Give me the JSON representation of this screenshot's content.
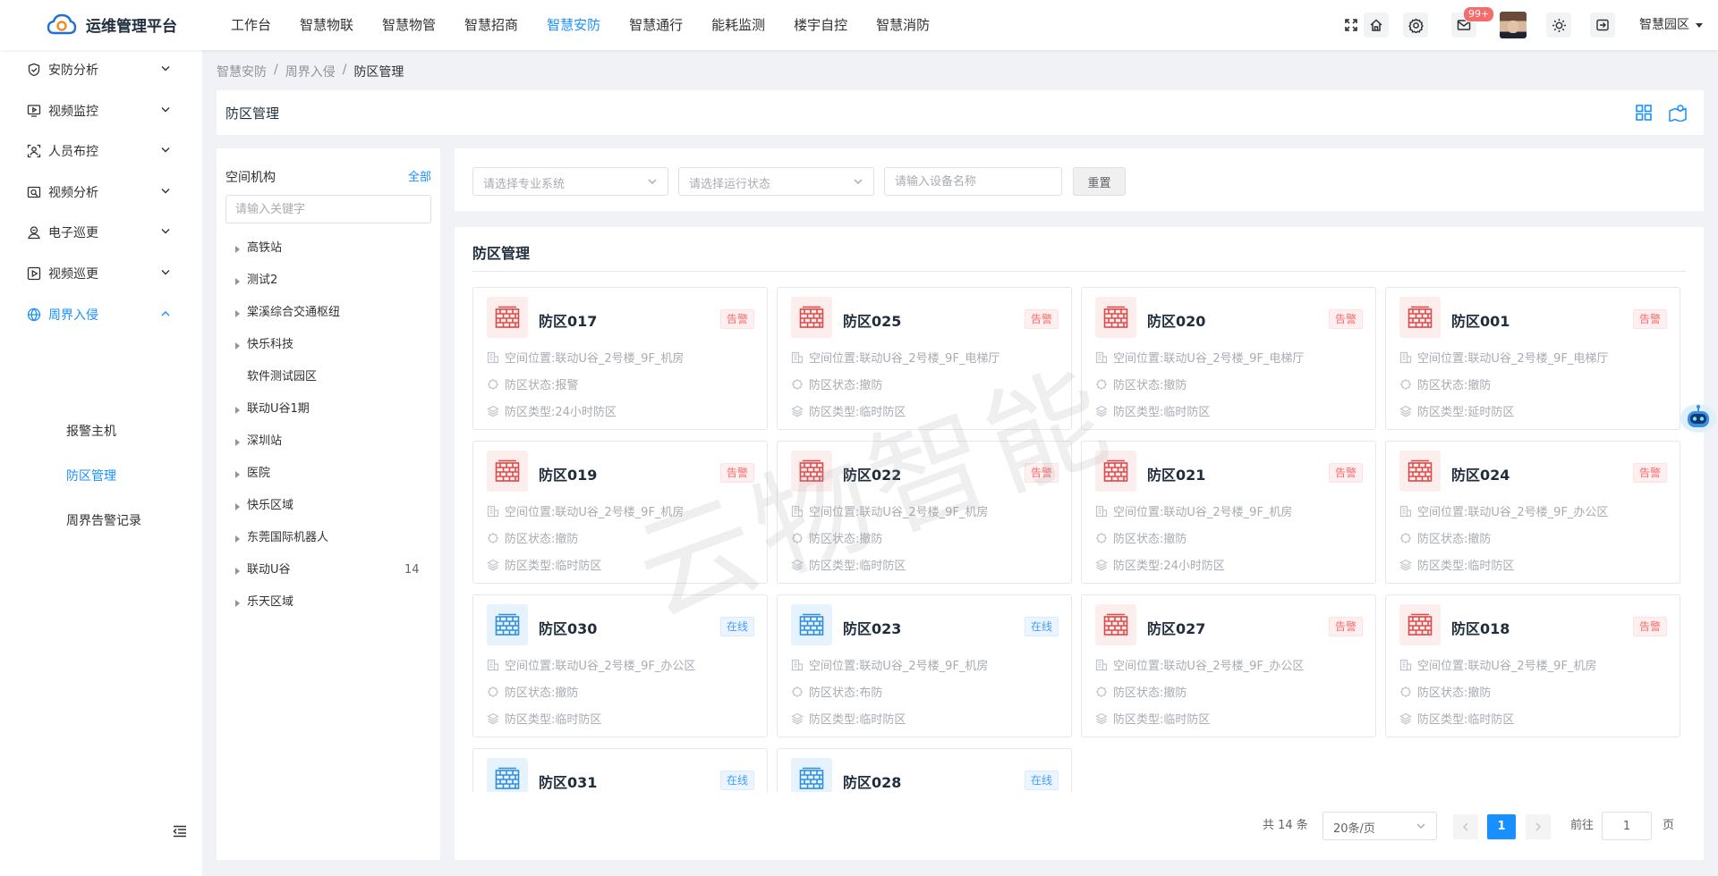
{
  "app": {
    "title": "运维管理平台"
  },
  "topnav": [
    {
      "label": "工作台",
      "active": false
    },
    {
      "label": "智慧物联",
      "active": false
    },
    {
      "label": "智慧物管",
      "active": false
    },
    {
      "label": "智慧招商",
      "active": false
    },
    {
      "label": "智慧安防",
      "active": true
    },
    {
      "label": "智慧通行",
      "active": false
    },
    {
      "label": "能耗监测",
      "active": false
    },
    {
      "label": "楼宇自控",
      "active": false
    },
    {
      "label": "智慧消防",
      "active": false
    }
  ],
  "header": {
    "mail_badge": "99+",
    "park_label": "智慧园区"
  },
  "sidebar": {
    "items": [
      {
        "label": "安防分析",
        "icon": "shield-check-icon"
      },
      {
        "label": "视频监控",
        "icon": "monitor-play-icon"
      },
      {
        "label": "人员布控",
        "icon": "person-scan-icon"
      },
      {
        "label": "视频分析",
        "icon": "video-search-icon"
      },
      {
        "label": "电子巡更",
        "icon": "patrol-icon"
      },
      {
        "label": "视频巡更",
        "icon": "video-play-icon"
      },
      {
        "label": "周界入侵",
        "icon": "globe-icon",
        "open": true
      }
    ],
    "subitems": [
      {
        "label": "报警主机",
        "active": false
      },
      {
        "label": "防区管理",
        "active": true
      },
      {
        "label": "周界告警记录",
        "active": false
      }
    ]
  },
  "breadcrumb": [
    "智慧安防",
    "周界入侵",
    "防区管理"
  ],
  "page": {
    "title": "防区管理"
  },
  "tree": {
    "title": "空间机构",
    "all_label": "全部",
    "search_placeholder": "请输入关键字",
    "nodes": [
      {
        "label": "高铁站",
        "expandable": true,
        "count": ""
      },
      {
        "label": "测试2",
        "expandable": true,
        "count": ""
      },
      {
        "label": "棠溪综合交通枢纽",
        "expandable": true,
        "count": ""
      },
      {
        "label": "快乐科技",
        "expandable": true,
        "count": ""
      },
      {
        "label": "软件测试园区",
        "expandable": false,
        "count": ""
      },
      {
        "label": "联动U谷1期",
        "expandable": true,
        "count": ""
      },
      {
        "label": "深圳站",
        "expandable": true,
        "count": ""
      },
      {
        "label": "医院",
        "expandable": true,
        "count": ""
      },
      {
        "label": "快乐区域",
        "expandable": true,
        "count": ""
      },
      {
        "label": "东莞国际机器人",
        "expandable": true,
        "count": ""
      },
      {
        "label": "联动U谷",
        "expandable": true,
        "count": "14"
      },
      {
        "label": "乐天区域",
        "expandable": true,
        "count": ""
      }
    ]
  },
  "filters": {
    "system_placeholder": "请选择专业系统",
    "status_placeholder": "请选择运行状态",
    "device_placeholder": "请输入设备名称",
    "reset_label": "重置"
  },
  "content": {
    "title": "防区管理"
  },
  "labels": {
    "location": "空间位置: ",
    "state": "防区状态: ",
    "type": "防区类型: "
  },
  "colors": {
    "accent": "#1890ff",
    "alarm": "#e04848",
    "online": "#2f8ee0"
  },
  "zones": [
    {
      "name": "防区017",
      "tag": "告警",
      "kind": "alarm",
      "location": "联动U谷_2号楼_9F_机房",
      "state": "报警",
      "type": "24小时防区"
    },
    {
      "name": "防区025",
      "tag": "告警",
      "kind": "alarm",
      "location": "联动U谷_2号楼_9F_电梯厅",
      "state": "撤防",
      "type": "临时防区"
    },
    {
      "name": "防区020",
      "tag": "告警",
      "kind": "alarm",
      "location": "联动U谷_2号楼_9F_电梯厅",
      "state": "撤防",
      "type": "临时防区"
    },
    {
      "name": "防区001",
      "tag": "告警",
      "kind": "alarm",
      "location": "联动U谷_2号楼_9F_电梯厅",
      "state": "撤防",
      "type": "延时防区"
    },
    {
      "name": "防区019",
      "tag": "告警",
      "kind": "alarm",
      "location": "联动U谷_2号楼_9F_机房",
      "state": "撤防",
      "type": "临时防区"
    },
    {
      "name": "防区022",
      "tag": "告警",
      "kind": "alarm",
      "location": "联动U谷_2号楼_9F_机房",
      "state": "撤防",
      "type": "临时防区"
    },
    {
      "name": "防区021",
      "tag": "告警",
      "kind": "alarm",
      "location": "联动U谷_2号楼_9F_机房",
      "state": "撤防",
      "type": "24小时防区"
    },
    {
      "name": "防区024",
      "tag": "告警",
      "kind": "alarm",
      "location": "联动U谷_2号楼_9F_办公区",
      "state": "撤防",
      "type": "临时防区"
    },
    {
      "name": "防区030",
      "tag": "在线",
      "kind": "online",
      "location": "联动U谷_2号楼_9F_办公区",
      "state": "撤防",
      "type": "临时防区"
    },
    {
      "name": "防区023",
      "tag": "在线",
      "kind": "online",
      "location": "联动U谷_2号楼_9F_机房",
      "state": "布防",
      "type": "临时防区"
    },
    {
      "name": "防区027",
      "tag": "告警",
      "kind": "alarm",
      "location": "联动U谷_2号楼_9F_办公区",
      "state": "撤防",
      "type": "临时防区"
    },
    {
      "name": "防区018",
      "tag": "告警",
      "kind": "alarm",
      "location": "联动U谷_2号楼_9F_机房",
      "state": "撤防",
      "type": "临时防区"
    },
    {
      "name": "防区031",
      "tag": "在线",
      "kind": "online",
      "location": "",
      "state": "",
      "type": ""
    },
    {
      "name": "防区028",
      "tag": "在线",
      "kind": "online",
      "location": "",
      "state": "",
      "type": ""
    }
  ],
  "pagination": {
    "total_text": "共 14 条",
    "page_size": "20条/页",
    "current_page": "1",
    "goto_label": "前往",
    "goto_value": "1",
    "page_suffix": "页"
  },
  "watermark": "云物智能"
}
